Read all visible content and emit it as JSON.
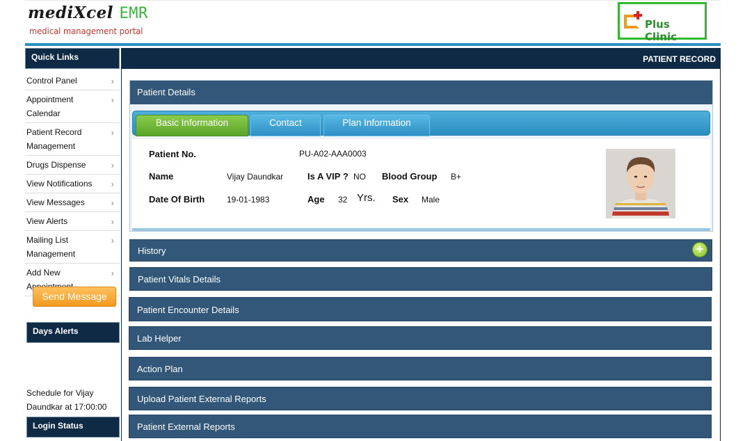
{
  "header": {
    "logo_brand": "mediXcel",
    "logo_suffix": "EMR",
    "logo_tagline": "medical management portal",
    "clinic_name": "Plus Clinic"
  },
  "sidebar": {
    "quick_links_title": "Quick Links",
    "items": [
      {
        "label": "Control Panel"
      },
      {
        "label": "Appointment Calendar"
      },
      {
        "label": "Patient Record Management"
      },
      {
        "label": "Drugs Dispense"
      },
      {
        "label": "View Notifications"
      },
      {
        "label": "View Messages"
      },
      {
        "label": "View Alerts"
      },
      {
        "label": "Mailing List Management"
      },
      {
        "label": "Add New Appointment"
      }
    ],
    "send_message_label": "Send Message",
    "days_alerts_title": "Days Alerts",
    "alert_text": "Schedule for Vijay Daundkar at 17:00:00",
    "login_status_title": "Login Status"
  },
  "main": {
    "title": "PATIENT RECORD",
    "patient_details_title": "Patient Details",
    "tabs": [
      {
        "label": "Basic Information",
        "active": true
      },
      {
        "label": "Contact",
        "active": false
      },
      {
        "label": "Plan Information",
        "active": false
      }
    ],
    "patient": {
      "patient_no_label": "Patient No.",
      "patient_no": "PU-A02-AAA0003",
      "name_label": "Name",
      "name": "Vijay Daundkar",
      "vip_label": "Is A VIP ?",
      "vip": "NO",
      "blood_group_label": "Blood Group",
      "blood_group": "B+",
      "dob_label": "Date Of Birth",
      "dob": "19-01-1983",
      "age_label": "Age",
      "age": "32",
      "age_unit": "Yrs.",
      "sex_label": "Sex",
      "sex": "Male"
    },
    "sections": [
      {
        "label": "History",
        "has_add": true
      },
      {
        "label": "Patient Vitals Details"
      },
      {
        "label": "Patient Encounter Details"
      },
      {
        "label": "Lab Helper"
      },
      {
        "label": "Action Plan"
      },
      {
        "label": "Upload Patient External Reports"
      },
      {
        "label": "Patient External Reports"
      }
    ]
  },
  "colors": {
    "nav_dark": "#0e2a44",
    "section_blue": "#325778",
    "tab_active_green": "#5aa52a",
    "tab_bar_blue": "#2a8ec1",
    "button_orange": "#f29a1d",
    "clinic_border_green": "#2dba2d"
  }
}
